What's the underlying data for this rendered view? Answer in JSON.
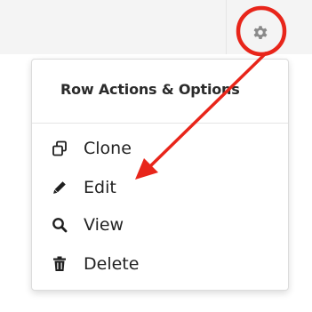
{
  "header": {
    "settings_icon": "gear-icon"
  },
  "dropdown": {
    "title": "Row Actions & Options",
    "items": [
      {
        "label": "Clone",
        "icon": "clone-icon"
      },
      {
        "label": "Edit",
        "icon": "pencil-icon"
      },
      {
        "label": "View",
        "icon": "search-icon"
      },
      {
        "label": "Delete",
        "icon": "trash-icon"
      }
    ]
  },
  "colors": {
    "annotation_red": "#e8251a",
    "icon_dark": "#1f1f1f",
    "gear_gray": "#8a8a8a",
    "toolbar_bg": "#f4f4f4"
  }
}
